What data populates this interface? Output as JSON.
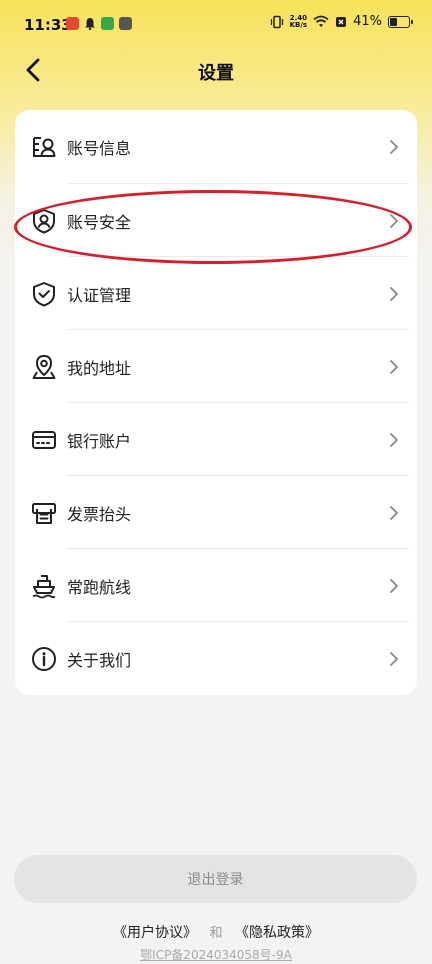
{
  "status_bar": {
    "time": "11:33",
    "net_speed_value": "2.40",
    "net_speed_unit": "KB/s",
    "battery": "41%"
  },
  "nav": {
    "title": "设置"
  },
  "settings": {
    "items": [
      {
        "label": "账号信息",
        "icon": "account-info-icon"
      },
      {
        "label": "账号安全",
        "icon": "account-security-icon"
      },
      {
        "label": "认证管理",
        "icon": "shield-check-icon"
      },
      {
        "label": "我的地址",
        "icon": "location-pin-icon"
      },
      {
        "label": "银行账户",
        "icon": "bank-card-icon"
      },
      {
        "label": "发票抬头",
        "icon": "invoice-printer-icon"
      },
      {
        "label": "常跑航线",
        "icon": "ship-icon"
      },
      {
        "label": "关于我们",
        "icon": "info-icon"
      }
    ]
  },
  "logout_label": "退出登录",
  "footer": {
    "user_agreement": "《用户协议》",
    "and": "和",
    "privacy_policy": "《隐私政策》",
    "icp": "鄂ICP备2024034058号-9A"
  },
  "colors": {
    "header_yellow": "#f8e25a",
    "highlight_red": "#d81e2b",
    "logout_bg": "#e4e4e4"
  }
}
